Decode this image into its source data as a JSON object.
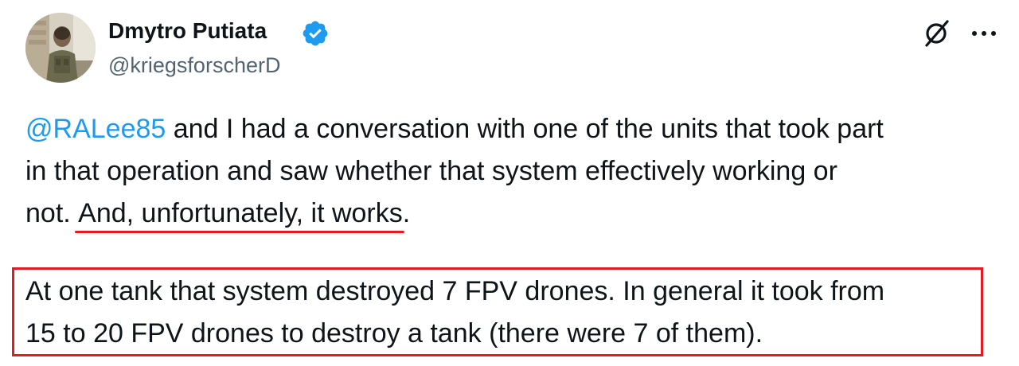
{
  "author": {
    "display_name": "Dmytro Putiata",
    "handle": "@kriegsforscherD",
    "verified_icon": "verified-badge-icon",
    "verified_color": "#1d9bf0"
  },
  "actions": {
    "grok_icon": "grok-icon",
    "more_icon": "more-options-icon"
  },
  "body": {
    "paragraph1": {
      "mention": "@RALee85",
      "line1_rest": " and I had a conversation with one of the units that took part",
      "line2": "in that operation and saw whether that system effectively working or",
      "line3_pre": "not. ",
      "line3_underlined": "And, unfortunately, it works",
      "line3_post": "."
    },
    "paragraph2": {
      "line1": "At one tank that system destroyed 7 FPV drones. In general it took from",
      "line2": "15 to 20 FPV drones to destroy a tank (there were 7 of them)."
    }
  },
  "colors": {
    "text": "#0f1419",
    "secondary": "#536471",
    "link": "#1d9bf0",
    "annotation_red": "#e31b23"
  }
}
